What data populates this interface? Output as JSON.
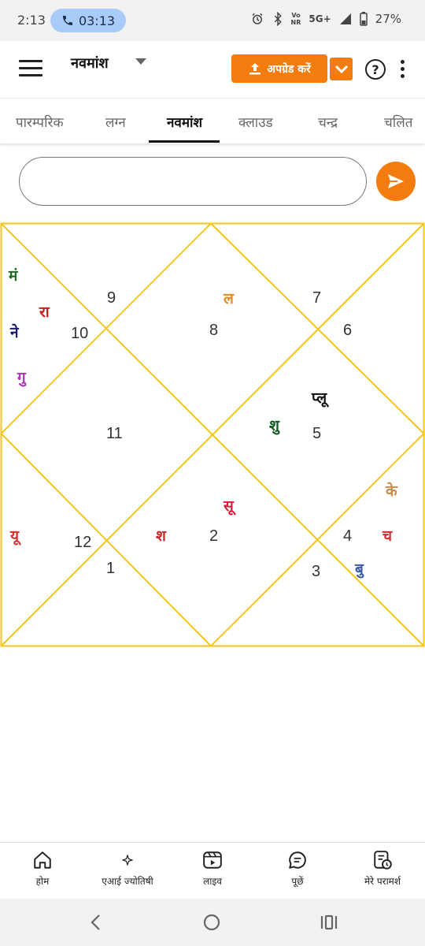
{
  "status_bar": {
    "time": "2:13",
    "call_timer": "03:13",
    "network_top": "Vo",
    "network_bottom": "NR",
    "signal_label": "5G+",
    "battery": "27%"
  },
  "app_bar": {
    "title": "नवमांश",
    "upgrade_label": "अपग्रेड करें",
    "help_label": "?",
    "accent": "#f47c0f"
  },
  "tabs": [
    {
      "label": "पारम्परिक",
      "active": false
    },
    {
      "label": "लग्न",
      "active": false
    },
    {
      "label": "नवमांश",
      "active": true
    },
    {
      "label": "क्लाउड",
      "active": false
    },
    {
      "label": "चन्द्र",
      "active": false
    },
    {
      "label": "चलित",
      "active": false
    }
  ],
  "query": {
    "value": "",
    "placeholder": ""
  },
  "chart": {
    "line_color": "#f5c518",
    "house_numbers": [
      "9",
      "10",
      "8",
      "7",
      "6",
      "11",
      "5",
      "12",
      "2",
      "4",
      "1",
      "3"
    ],
    "planets": [
      {
        "label": "मं",
        "color": "#1f6e1f"
      },
      {
        "label": "रा",
        "color": "#c41e1e"
      },
      {
        "label": "ने",
        "color": "#1a1a6e"
      },
      {
        "label": "गु",
        "color": "#a63ab0"
      },
      {
        "label": "ल",
        "color": "#e8891b"
      },
      {
        "label": "प्लू",
        "color": "#111111"
      },
      {
        "label": "शु",
        "color": "#0f5a1a"
      },
      {
        "label": "सू",
        "color": "#d61f3c"
      },
      {
        "label": "श",
        "color": "#c62828"
      },
      {
        "label": "के",
        "color": "#c98a4b"
      },
      {
        "label": "च",
        "color": "#d32f2f"
      },
      {
        "label": "बु",
        "color": "#3a5ba8"
      },
      {
        "label": "यू",
        "color": "#d32f2f"
      }
    ]
  },
  "bottom_nav": [
    {
      "label": "होम",
      "icon": "home-icon"
    },
    {
      "label": "एआई ज्योतिषी",
      "icon": "sparkle-icon"
    },
    {
      "label": "लाइव",
      "icon": "live-video-icon"
    },
    {
      "label": "पूछें",
      "icon": "chat-icon"
    },
    {
      "label": "मेरे परामर्श",
      "icon": "consultation-icon"
    }
  ]
}
